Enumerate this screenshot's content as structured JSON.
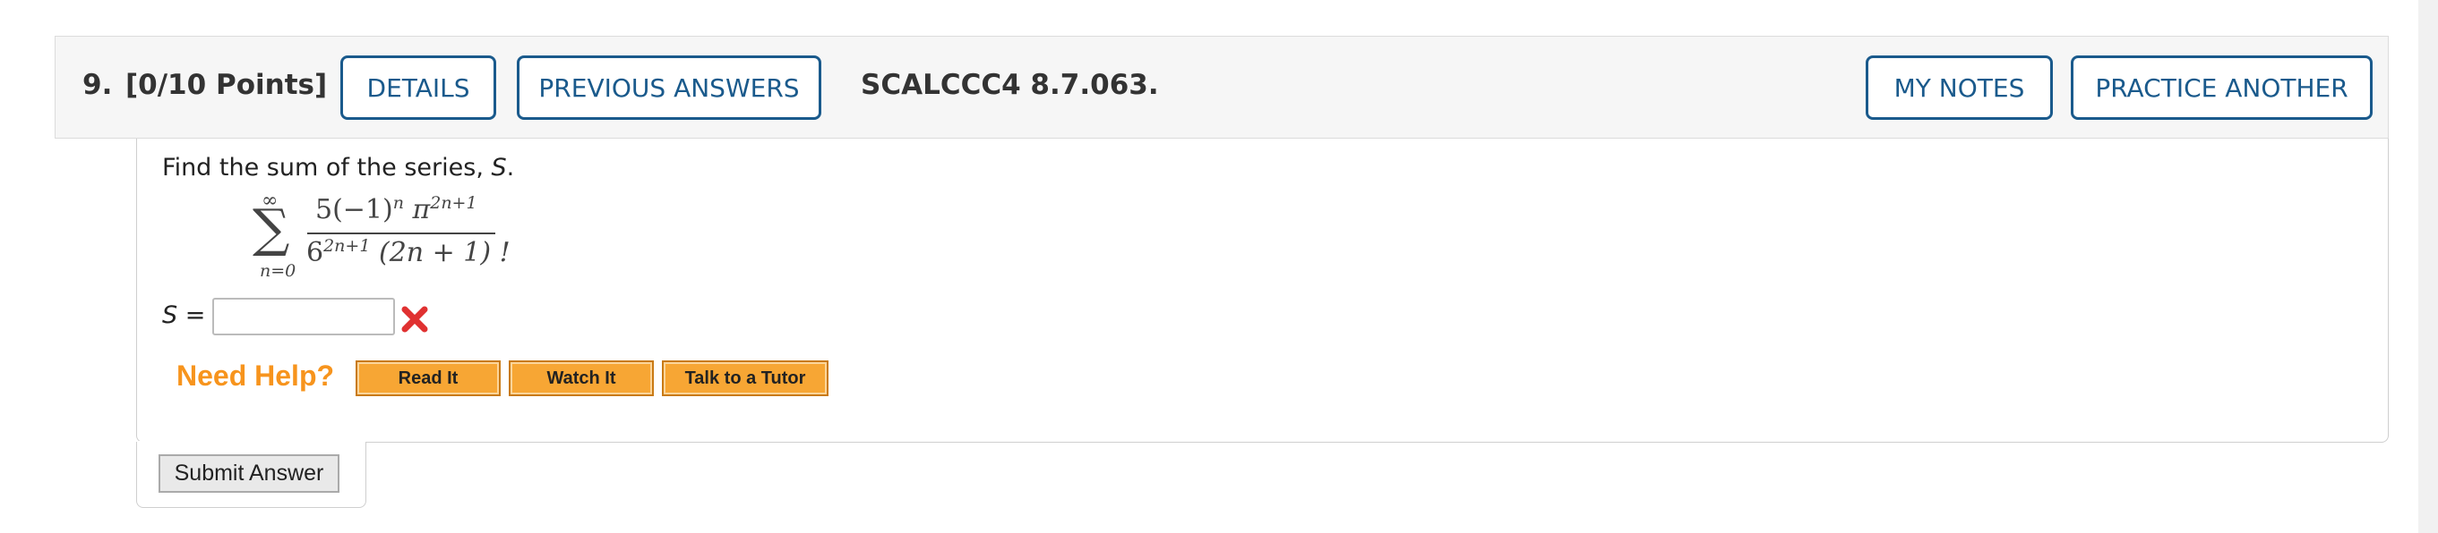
{
  "question": {
    "number": "9.",
    "points": "[0/10 Points]",
    "details_label": "DETAILS",
    "previous_answers_label": "PREVIOUS ANSWERS",
    "code": "SCALCCC4 8.7.063.",
    "my_notes_label": "MY NOTES",
    "practice_another_label": "PRACTICE ANOTHER"
  },
  "problem": {
    "prompt_prefix": "Find the sum of the series, ",
    "prompt_var": "S",
    "prompt_suffix": ".",
    "sum_upper": "∞",
    "sum_symbol": "∑",
    "sum_lower": "n=0",
    "numerator": "5(−1)",
    "numerator_exp1": "n",
    "numerator_pi": " π",
    "numerator_exp2": "2n+1",
    "denominator": "6",
    "denominator_exp": "2n+1",
    "denominator_rest": "(2n + 1) !"
  },
  "answer": {
    "label_var": "S",
    "label_eq": " =",
    "value": "",
    "status": "incorrect",
    "status_color": "#e03131"
  },
  "help": {
    "title": "Need Help?",
    "read_it": "Read It",
    "watch_it": "Watch It",
    "talk_to_tutor": "Talk to a Tutor"
  },
  "submit_label": "Submit Answer",
  "colors": {
    "accent": "#1a5a8c",
    "help_orange": "#f7941d",
    "help_button": "#f7a634"
  }
}
